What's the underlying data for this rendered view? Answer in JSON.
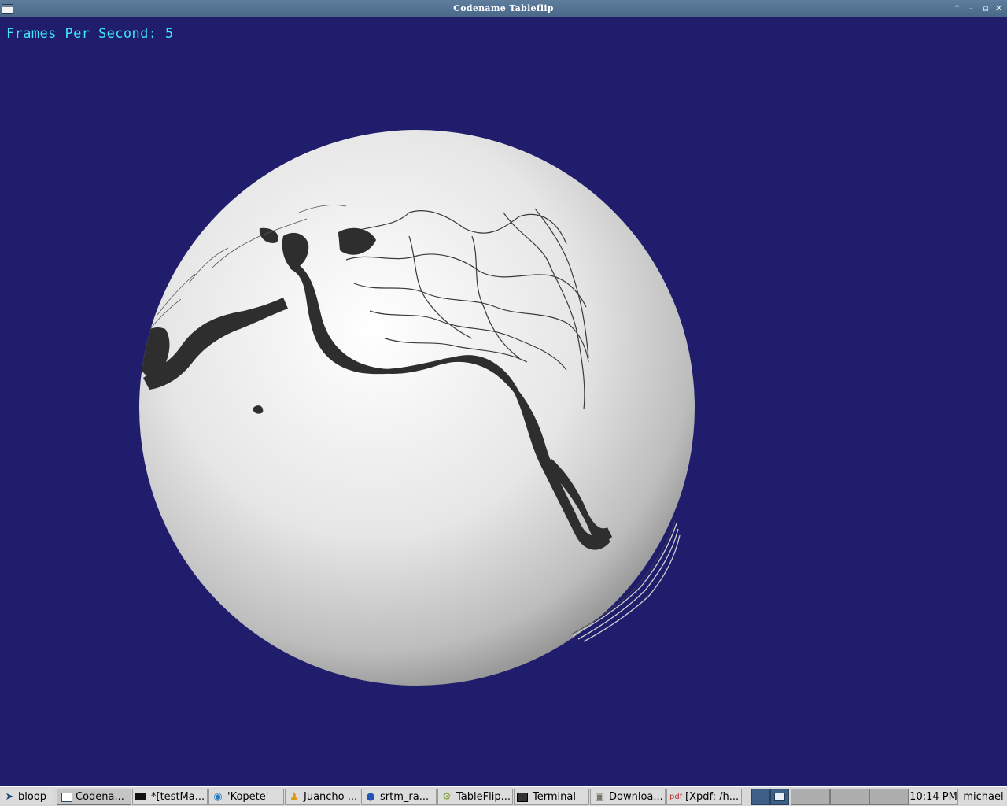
{
  "window": {
    "title": "Codename Tableflip"
  },
  "overlay": {
    "fps_text": "Frames Per Second: 5"
  },
  "colors": {
    "background": "#201e6c",
    "fps_text": "#3ce7f7",
    "titlebar": "#4f6d8d",
    "terrain_lines": "#2e2e2e"
  },
  "taskbar": {
    "items": [
      {
        "label": "bloop",
        "icon": "app-launcher-icon"
      },
      {
        "label": "Codena...",
        "icon": "window-icon",
        "active": true
      },
      {
        "label": "*[testMa...",
        "icon": "terminal-icon"
      },
      {
        "label": "'Kopete'",
        "icon": "kopete-icon"
      },
      {
        "label": "Juancho ...",
        "icon": "chat-person-icon"
      },
      {
        "label": "srtm_ra...",
        "icon": "browser-icon"
      },
      {
        "label": "TableFlip...",
        "icon": "gear-icon"
      },
      {
        "label": "Terminal",
        "icon": "terminal-icon"
      },
      {
        "label": "Downloa...",
        "icon": "folder-icon"
      },
      {
        "label": "[Xpdf: /h...",
        "icon": "pdf-icon"
      }
    ],
    "clock": "10:14 PM",
    "user": "michael"
  }
}
